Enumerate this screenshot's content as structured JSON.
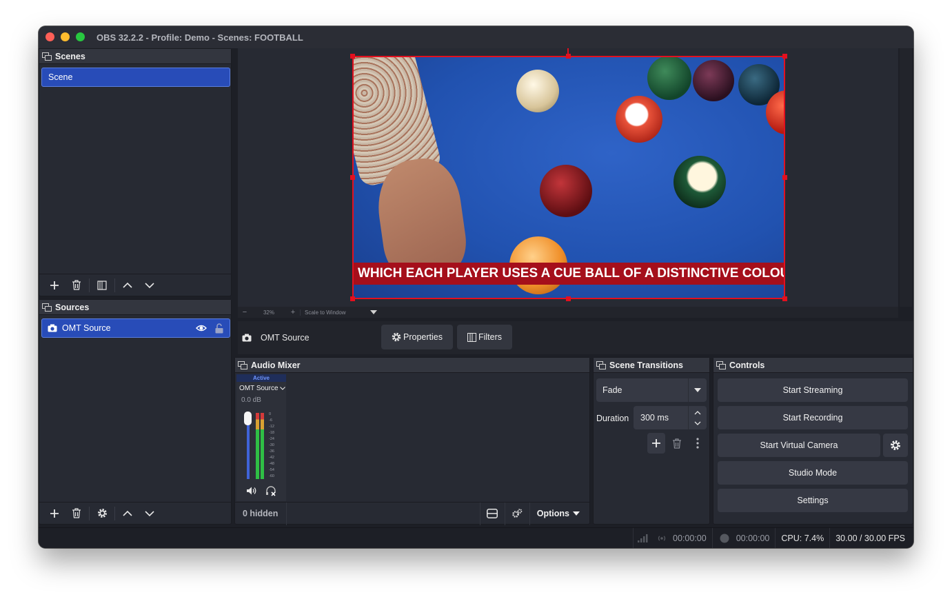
{
  "window": {
    "title": "OBS 32.2.2 - Profile: Demo - Scenes: FOOTBALL"
  },
  "scenes": {
    "header": "Scenes",
    "items": [
      {
        "label": "Scene",
        "selected": true
      }
    ]
  },
  "sources": {
    "header": "Sources",
    "items": [
      {
        "label": "OMT Source",
        "visible": true,
        "locked": false,
        "selected": true
      }
    ]
  },
  "preview": {
    "ticker_text": "WHICH EACH PLAYER USES A CUE BALL OF A DISTINCTIVE COLOU",
    "zoom": "32%",
    "scale_mode": "Scale to Window"
  },
  "source_toolbar": {
    "source_name": "OMT Source",
    "properties_label": "Properties",
    "filters_label": "Filters"
  },
  "audio_mixer": {
    "header": "Audio Mixer",
    "channel": {
      "status": "Active",
      "name": "OMT Source",
      "volume": "0.0 dB",
      "scale_ticks": [
        "0",
        "-6",
        "-12",
        "-18",
        "-24",
        "-30",
        "-36",
        "-42",
        "-48",
        "-54",
        "-60"
      ]
    },
    "hidden_label": "0 hidden",
    "options_label": "Options"
  },
  "transitions": {
    "header": "Scene Transitions",
    "selected": "Fade",
    "duration_label": "Duration",
    "duration_value": "300 ms"
  },
  "controls": {
    "header": "Controls",
    "start_streaming": "Start Streaming",
    "start_recording": "Start Recording",
    "start_virtual_camera": "Start Virtual Camera",
    "studio_mode": "Studio Mode",
    "settings": "Settings"
  },
  "status": {
    "stream_time": "00:00:00",
    "record_time": "00:00:00",
    "cpu": "CPU: 7.4%",
    "fps": "30.00 / 30.00 FPS"
  },
  "colors": {
    "accent": "#284cb8",
    "selection": "#e3101f",
    "panel": "#272a33"
  }
}
